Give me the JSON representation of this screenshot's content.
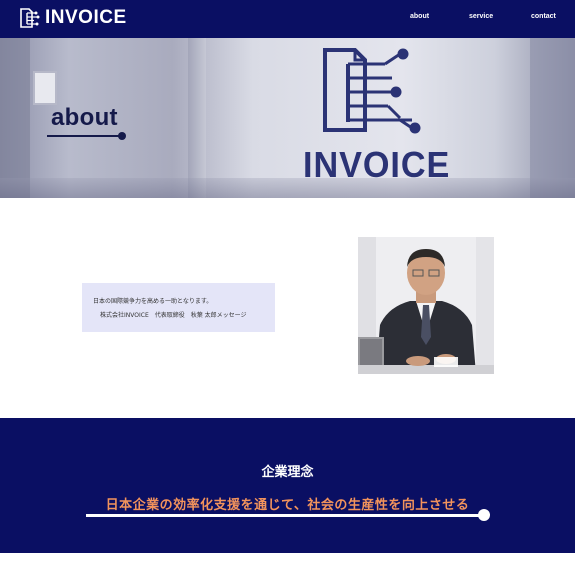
{
  "header": {
    "logo_text": "INVOICE",
    "nav": [
      {
        "label": "about"
      },
      {
        "label": "service"
      },
      {
        "label": "contact"
      }
    ]
  },
  "hero": {
    "title": "about",
    "glass_text": "INVOICE"
  },
  "message": {
    "line1": "日本の国際競争力を高める一助となります。",
    "line2": "株式会社INVOICE　代表取締役　秋葉 太郎メッセージ"
  },
  "philosophy": {
    "title": "企業理念",
    "slogan": "日本企業の効率化支援を通じて、社会の生産性を向上させる"
  },
  "colors": {
    "navy": "#0a0f63",
    "accent_orange": "#f2935c",
    "message_bg": "#e4e5f8"
  }
}
